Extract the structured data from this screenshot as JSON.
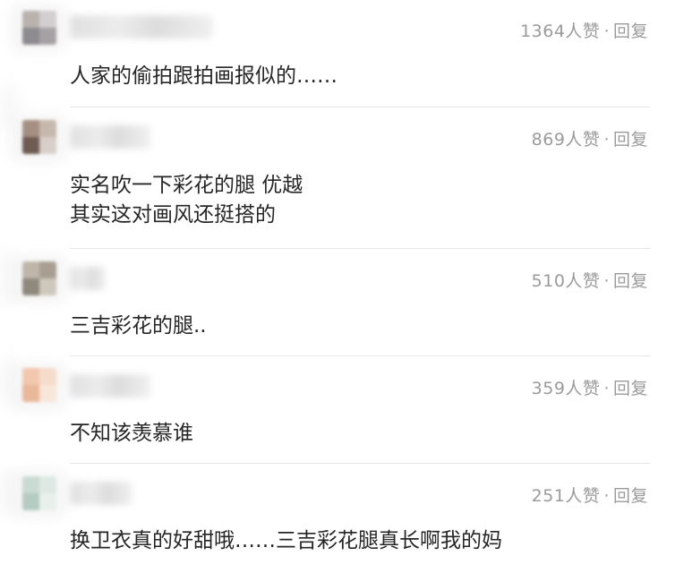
{
  "comments": [
    {
      "likes": "1364人赞",
      "separator": "·",
      "reply_label": "回复",
      "lines": [
        "人家的偷拍跟拍画报似的……"
      ],
      "avatar_colors": [
        "#b9b2ad",
        "#d3ced0",
        "#8d8a90",
        "#a6a1a4"
      ],
      "username_width": 160
    },
    {
      "likes": "869人赞",
      "separator": "·",
      "reply_label": "回复",
      "lines": [
        "实名吹一下彩花的腿 优越",
        "其实这对画风还挺搭的"
      ],
      "avatar_colors": [
        "#a58f82",
        "#c7b8ae",
        "#6e5b52",
        "#d8cfc9"
      ],
      "username_width": 90
    },
    {
      "likes": "510人赞",
      "separator": "·",
      "reply_label": "回复",
      "lines": [
        "三吉彩花的腿.."
      ],
      "avatar_colors": [
        "#bfb6a9",
        "#a89f92",
        "#8f887d",
        "#cfc8bd"
      ],
      "username_width": 40
    },
    {
      "likes": "359人赞",
      "separator": "·",
      "reply_label": "回复",
      "lines": [
        "不知该羡慕谁"
      ],
      "avatar_colors": [
        "#f1c8ae",
        "#f6dccb",
        "#e9b89a",
        "#f8e6da"
      ],
      "username_width": 90
    },
    {
      "likes": "251人赞",
      "separator": "·",
      "reply_label": "回复",
      "lines": [
        "换卫衣真的好甜哦……三吉彩花腿真长啊我的妈"
      ],
      "avatar_colors": [
        "#c9dbd3",
        "#dfe9e4",
        "#b4ccc1",
        "#e9f0ec"
      ],
      "username_width": 70
    }
  ],
  "colors": {
    "meta_text": "#9b9b9b",
    "body_text": "#262626",
    "divider": "#e6e6e6"
  }
}
